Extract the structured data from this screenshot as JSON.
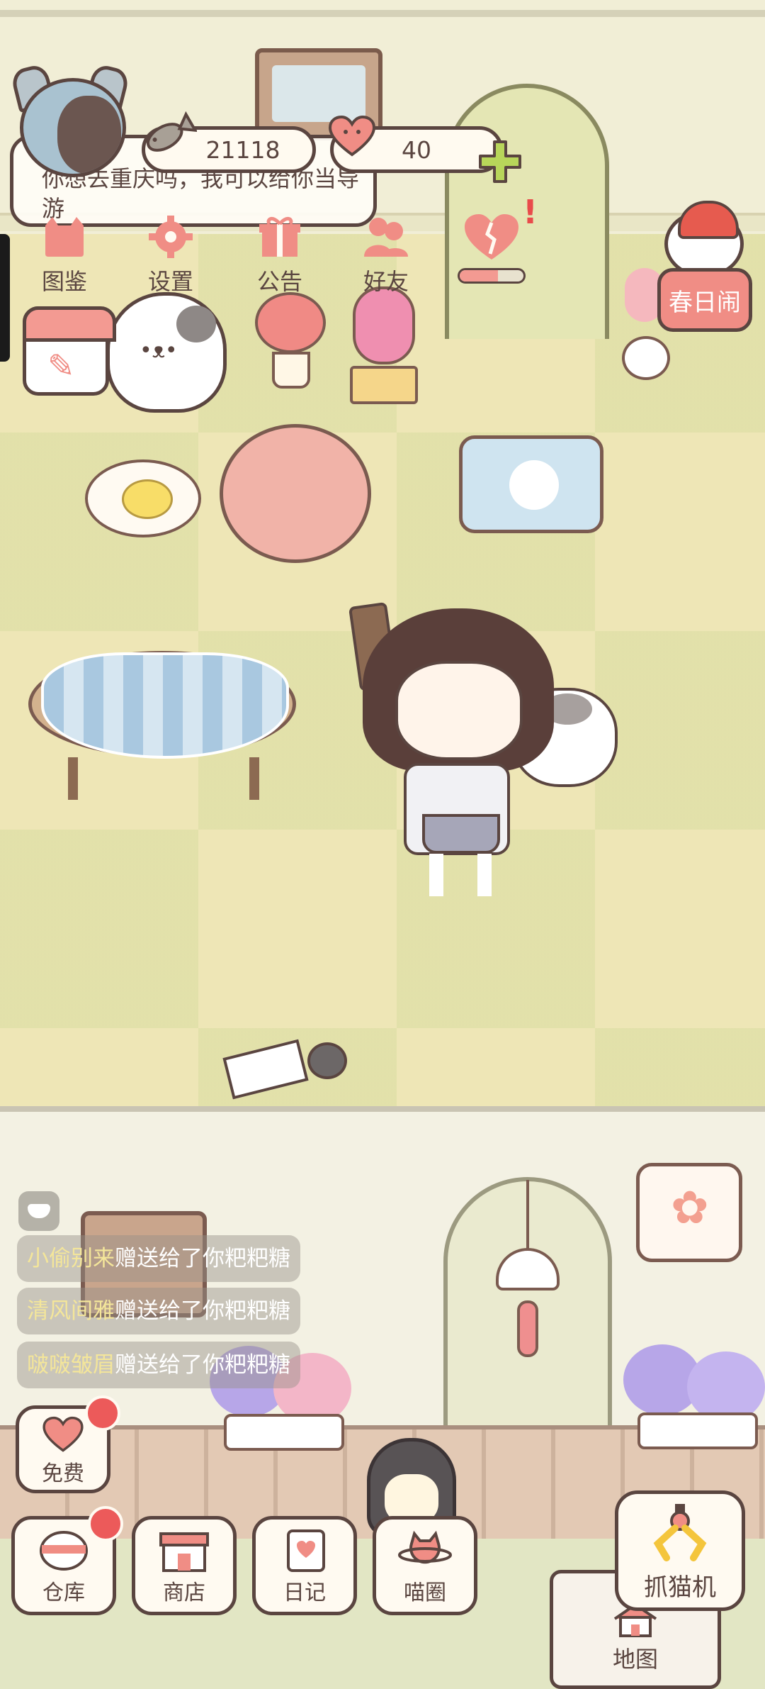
{
  "status": {
    "fish_coins": "21118",
    "hearts": "40"
  },
  "chat": {
    "text": "你想去重庆吗，我可以给你当导游"
  },
  "top_menu": [
    {
      "label": "图鉴",
      "icon": "cat-book-icon"
    },
    {
      "label": "设置",
      "icon": "gear-icon"
    },
    {
      "label": "公告",
      "icon": "gift-icon"
    },
    {
      "label": "好友",
      "icon": "friends-icon"
    }
  ],
  "heart_meter": {
    "fill_fraction": 0.6
  },
  "event": {
    "label": "春日闹"
  },
  "gift_feed": [
    {
      "sender": "小偷别来",
      "action": "赠送给了你粑粑糖"
    },
    {
      "sender": "清风间雅",
      "action": "赠送给了你粑粑糖"
    },
    {
      "sender": "啵啵皱眉",
      "action": "赠送给了你粑粑糖"
    }
  ],
  "bottom_bar": {
    "free": "免费",
    "warehouse": "仓库",
    "shop": "商店",
    "diary": "日记",
    "meow_circle": "喵圈",
    "claw_machine": "抓猫机",
    "map": "地图"
  },
  "colors": {
    "outline": "#5a4540",
    "accent_pink": "#f08d85",
    "badge_red": "#ec5a5a",
    "floor": "#eee6b6"
  }
}
